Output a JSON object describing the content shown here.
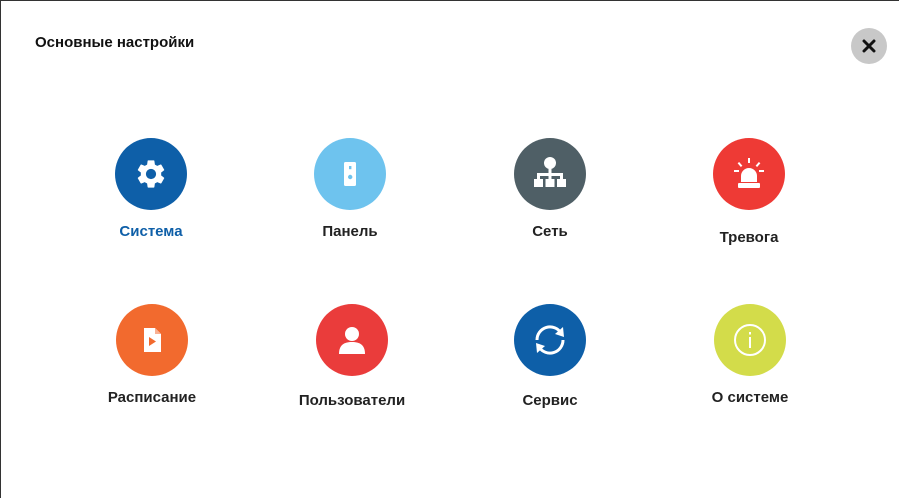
{
  "dialog": {
    "title": "Основные настройки",
    "close_icon": "close-icon"
  },
  "menu": {
    "items": [
      {
        "label": "Система",
        "icon": "gear-icon",
        "color": "#0e5fa8",
        "active": true
      },
      {
        "label": "Панель",
        "icon": "door-panel-icon",
        "color": "#6ec3ee",
        "active": false
      },
      {
        "label": "Сеть",
        "icon": "network-icon",
        "color": "#4f5f66",
        "active": false
      },
      {
        "label": "Тревога",
        "icon": "alarm-siren-icon",
        "color": "#ee3a35",
        "active": false
      },
      {
        "label": "Расписание",
        "icon": "schedule-play-icon",
        "color": "#f26a2e",
        "active": false
      },
      {
        "label": "Пользователи",
        "icon": "user-icon",
        "color": "#ea3c3b",
        "active": false
      },
      {
        "label": "Сервис",
        "icon": "refresh-icon",
        "color": "#0e5fa8",
        "active": false
      },
      {
        "label": "О системе",
        "icon": "info-icon",
        "color": "#d3dc4a",
        "active": false
      }
    ]
  }
}
